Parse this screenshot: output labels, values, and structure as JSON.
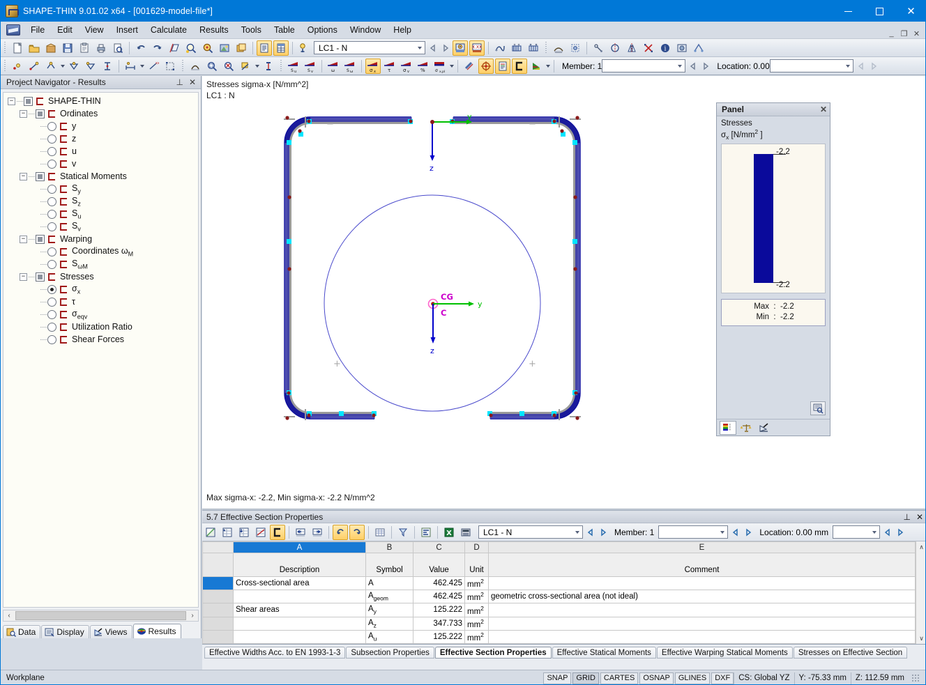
{
  "window": {
    "title": "SHAPE-THIN 9.01.02 x64 - [001629-model-file*]",
    "minimize": "–",
    "maximize": "□",
    "close": "✕"
  },
  "menu": {
    "items": [
      {
        "label": "File"
      },
      {
        "label": "Edit"
      },
      {
        "label": "View"
      },
      {
        "label": "Insert"
      },
      {
        "label": "Calculate"
      },
      {
        "label": "Results"
      },
      {
        "label": "Tools"
      },
      {
        "label": "Table"
      },
      {
        "label": "Options"
      },
      {
        "label": "Window"
      },
      {
        "label": "Help"
      }
    ],
    "mdi": {
      "minimize": "_",
      "restore": "❐",
      "close": "✕"
    }
  },
  "toolbar1": {
    "loadcase_value": "LC1 - N",
    "icons": [
      "new-file-icon",
      "open-folder-icon",
      "package-icon",
      "save-icon",
      "clipboard-icon",
      "print-icon",
      "print-preview-icon",
      "undo-icon",
      "redo-icon",
      "skew-icon",
      "zoom-in-icon",
      "zoom-target-icon",
      "render-icon",
      "copy-window-icon",
      "table-list-icon",
      "table-grid-icon",
      "load-case-icon",
      "prev-icon",
      "next-icon",
      "show-results-icon",
      "result-values-icon",
      "wire-icon",
      "animation-icon",
      "animation2-icon",
      "mesh-icon",
      "mesh-settings-icon",
      "snap-icon",
      "symmetry-icon",
      "mirror-icon",
      "intersection-icon",
      "info-icon",
      "photo-icon",
      "printout-icon"
    ]
  },
  "toolbar2": {
    "member_label": "Member: 1",
    "location_label": "Location: 0.00",
    "stress_buttons": [
      {
        "name": "su-icon",
        "label": "Su"
      },
      {
        "name": "sv-icon",
        "label": "Sv"
      },
      {
        "name": "omega-icon",
        "label": "ω"
      },
      {
        "name": "s-omega-icon",
        "label": "Sω"
      },
      {
        "name": "sigma-x-icon",
        "label": "σx",
        "active": true
      },
      {
        "name": "tau-icon",
        "label": "τ"
      },
      {
        "name": "sigma-v-icon",
        "label": "σv"
      },
      {
        "name": "percent-icon",
        "label": "%"
      },
      {
        "name": "sigma-xpl-icon",
        "label": "σx,pl"
      }
    ]
  },
  "navigator": {
    "title": "Project Navigator - Results",
    "pin_icon": "⊥",
    "close_icon": "✕",
    "tree": [
      {
        "level": 0,
        "twist": "−",
        "ctrl": "check",
        "label": "SHAPE-THIN"
      },
      {
        "level": 1,
        "twist": "−",
        "ctrl": "check",
        "label": "Ordinates"
      },
      {
        "level": 2,
        "twist": "",
        "ctrl": "radio",
        "label": "y"
      },
      {
        "level": 2,
        "twist": "",
        "ctrl": "radio",
        "label": "z"
      },
      {
        "level": 2,
        "twist": "",
        "ctrl": "radio",
        "label": "u"
      },
      {
        "level": 2,
        "twist": "",
        "ctrl": "radio",
        "label": "v"
      },
      {
        "level": 1,
        "twist": "−",
        "ctrl": "check",
        "label": "Statical Moments"
      },
      {
        "level": 2,
        "twist": "",
        "ctrl": "radio",
        "label": "S",
        "sub": "y"
      },
      {
        "level": 2,
        "twist": "",
        "ctrl": "radio",
        "label": "S",
        "sub": "z"
      },
      {
        "level": 2,
        "twist": "",
        "ctrl": "radio",
        "label": "S",
        "sub": "u"
      },
      {
        "level": 2,
        "twist": "",
        "ctrl": "radio",
        "label": "S",
        "sub": "v"
      },
      {
        "level": 1,
        "twist": "−",
        "ctrl": "check",
        "label": "Warping"
      },
      {
        "level": 2,
        "twist": "",
        "ctrl": "radio",
        "label": "Coordinates ω",
        "sub": "M"
      },
      {
        "level": 2,
        "twist": "",
        "ctrl": "radio",
        "label": "S",
        "sub": "ωM"
      },
      {
        "level": 1,
        "twist": "−",
        "ctrl": "check",
        "label": "Stresses"
      },
      {
        "level": 2,
        "twist": "",
        "ctrl": "radio",
        "selected": true,
        "label": "σ",
        "sub": "x"
      },
      {
        "level": 2,
        "twist": "",
        "ctrl": "radio",
        "label": "τ"
      },
      {
        "level": 2,
        "twist": "",
        "ctrl": "radio",
        "label": "σ",
        "sub": "eqv"
      },
      {
        "level": 2,
        "twist": "",
        "ctrl": "radio",
        "label": "Utilization Ratio"
      },
      {
        "level": 2,
        "twist": "",
        "ctrl": "radio",
        "label": "Shear Forces"
      }
    ],
    "tabs": [
      {
        "label": "Data",
        "icon": "data-icon",
        "selected": false
      },
      {
        "label": "Display",
        "icon": "display-icon",
        "selected": false
      },
      {
        "label": "Views",
        "icon": "views-icon",
        "selected": false
      },
      {
        "label": "Results",
        "icon": "results-icon",
        "selected": true
      }
    ],
    "scroll": {
      "left": "‹",
      "right": "›"
    }
  },
  "workarea": {
    "label_line1": "Stresses sigma-x [N/mm^2]",
    "label_line2": "LC1 : N",
    "footer": "Max sigma-x: -2.2, Min sigma-x: -2.2 N/mm^2",
    "axis_labels": {
      "origin_y": "y",
      "origin_z": "z",
      "cg_label": "CG",
      "c_label": "C",
      "cg_y": "y",
      "cg_z": "z"
    },
    "minus_marks": [
      "−",
      "−"
    ],
    "plus_marks": [
      "+",
      "+"
    ]
  },
  "panel": {
    "title": "Panel",
    "close_icon": "✕",
    "section_title": "Stresses",
    "unit_symbol": "σ",
    "unit_sub": "x",
    "unit_text": " [N/mm",
    "unit_sup": "2",
    "unit_tail": " ]",
    "legend_top_value": "-2.2",
    "legend_bottom_value": "-2.2",
    "legend_color": "#0a0a9b",
    "max_label": "Max",
    "max_value": "-2.2",
    "min_label": "Min",
    "min_value": "-2.2",
    "colon": ":",
    "tabs": [
      {
        "name": "color-scale-tab",
        "selected": true
      },
      {
        "name": "factors-tab",
        "selected": false
      },
      {
        "name": "view-angle-tab",
        "selected": false
      }
    ]
  },
  "table_pane": {
    "title": "5.7 Effective Section Properties",
    "pin_icon": "⊥",
    "close_icon": "✕",
    "loadcase_value": "LC1 - N",
    "member_label": "Member: 1",
    "location_label": "Location: 0.00 mm",
    "column_letters": [
      "A",
      "B",
      "C",
      "D",
      "E"
    ],
    "field_headers": [
      "Description",
      "Symbol",
      "Value",
      "Unit",
      "Comment"
    ],
    "rows": [
      {
        "selected": true,
        "description": "Cross-sectional area",
        "symbol": "A",
        "symbol_sub": "",
        "value": "462.425",
        "unit": "mm",
        "unit_sup": "2",
        "comment": ""
      },
      {
        "selected": false,
        "description": "",
        "symbol": "A",
        "symbol_sub": "geom",
        "value": "462.425",
        "unit": "mm",
        "unit_sup": "2",
        "comment": "geometric cross-sectional area (not ideal)"
      },
      {
        "selected": false,
        "description": "Shear areas",
        "symbol": "A",
        "symbol_sub": "y",
        "value": "125.222",
        "unit": "mm",
        "unit_sup": "2",
        "comment": ""
      },
      {
        "selected": false,
        "description": "",
        "symbol": "A",
        "symbol_sub": "z",
        "value": "347.733",
        "unit": "mm",
        "unit_sup": "2",
        "comment": ""
      },
      {
        "selected": false,
        "description": "",
        "symbol": "A",
        "symbol_sub": "u",
        "value": "125.222",
        "unit": "mm",
        "unit_sup": "2",
        "comment": ""
      }
    ],
    "scroll": {
      "up": "∧",
      "down": "∨"
    }
  },
  "doc_tabs": [
    {
      "label": "Effective Widths Acc. to EN 1993-1-3",
      "selected": false
    },
    {
      "label": "Subsection Properties",
      "selected": false
    },
    {
      "label": "Effective Section Properties",
      "selected": true
    },
    {
      "label": "Effective Statical Moments",
      "selected": false
    },
    {
      "label": "Effective Warping Statical Moments",
      "selected": false
    },
    {
      "label": "Stresses on Effective Section",
      "selected": false
    }
  ],
  "statusbar": {
    "workplane": "Workplane",
    "toggles": [
      {
        "label": "SNAP",
        "on": false
      },
      {
        "label": "GRID",
        "on": true
      },
      {
        "label": "CARTES",
        "on": false
      },
      {
        "label": "OSNAP",
        "on": false
      },
      {
        "label": "GLINES",
        "on": false
      },
      {
        "label": "DXF",
        "on": false
      }
    ],
    "cs": "CS: Global YZ",
    "y_coord": "Y:  -75.33 mm",
    "z_coord": "Z:  112.59 mm"
  },
  "colors": {
    "title_blue": "#0078d7",
    "accent_blue": "#1779d4",
    "stress_blue": "#00009b",
    "section_gray": "#9a9a9a",
    "node_cyan": "#00e5ff",
    "node_red": "#8b1a1a",
    "axis_green": "#00c000",
    "axis_blue": "#0000cc",
    "cg_magenta": "#cc00cc",
    "circle_blue": "#4444cc"
  }
}
